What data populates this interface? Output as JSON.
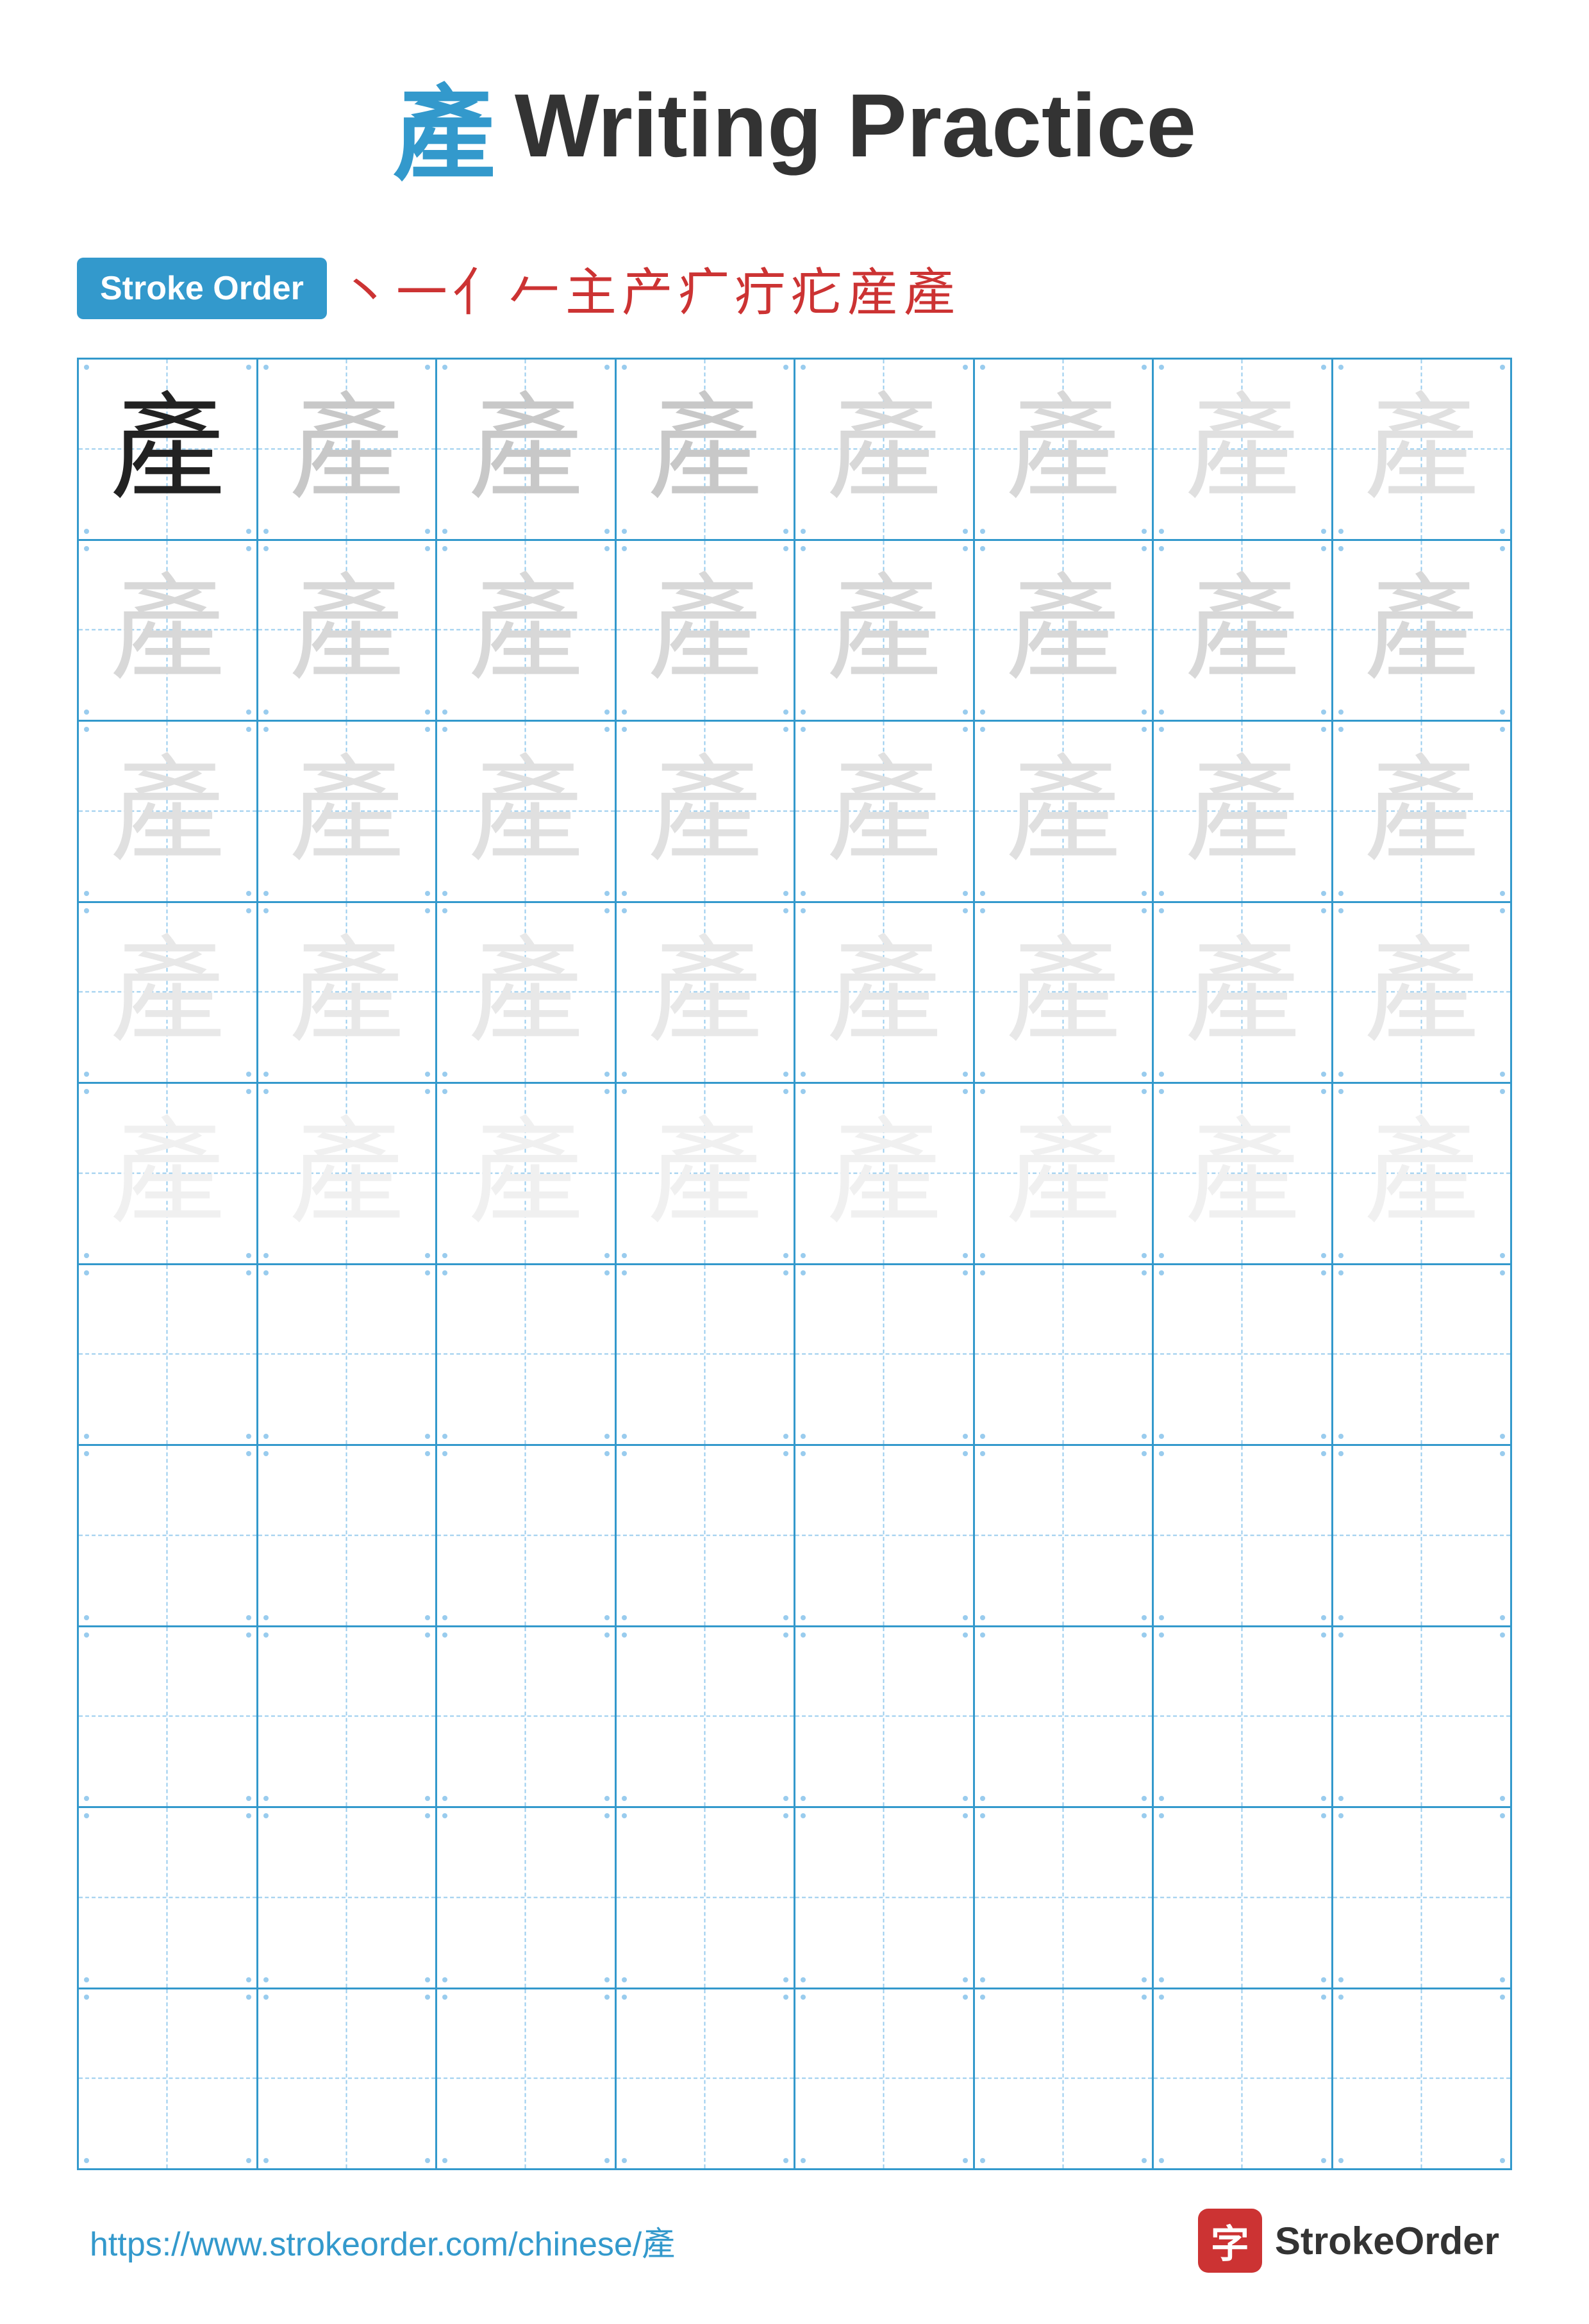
{
  "title": {
    "char": "產",
    "text": "Writing Practice"
  },
  "stroke_order": {
    "badge_label": "Stroke Order",
    "strokes": [
      "丶",
      "一",
      "亻",
      "𠂉",
      "主",
      "产",
      "疒",
      "疔",
      "疕",
      "産",
      "產"
    ]
  },
  "grid": {
    "cols": 8,
    "practice_rows": 5,
    "empty_rows": 5,
    "practice_char": "產",
    "char_opacities": [
      "dark",
      "light1",
      "light1",
      "light1",
      "light2",
      "light2",
      "light3",
      "light3",
      "light2",
      "light2",
      "light2",
      "light2",
      "light2",
      "light2",
      "light2",
      "light2",
      "light3",
      "light3",
      "light3",
      "light3",
      "light3",
      "light3",
      "light3",
      "light3",
      "light4",
      "light4",
      "light4",
      "light4",
      "light4",
      "light4",
      "light4",
      "light4",
      "light5",
      "light5",
      "light5",
      "light5",
      "light5",
      "light5",
      "light5",
      "light5"
    ]
  },
  "footer": {
    "url": "https://www.strokeorder.com/chinese/產",
    "logo_char": "字",
    "logo_text": "StrokeOrder"
  }
}
